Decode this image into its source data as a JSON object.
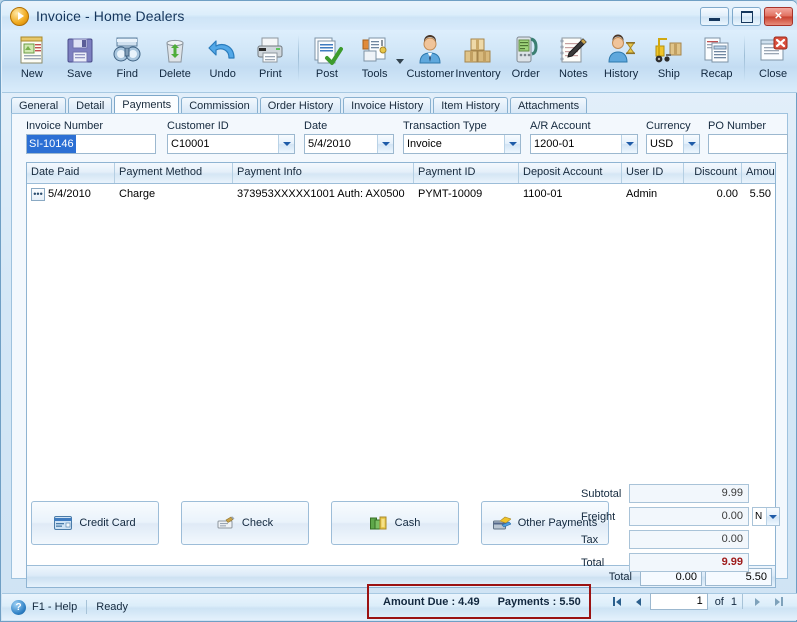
{
  "window": {
    "title": "Invoice - Home Dealers",
    "app_icon": "play-circle-icon",
    "buttons": {
      "minimize": "Minimize",
      "maximize": "Maximize",
      "close": "Close"
    }
  },
  "toolbar": {
    "items": [
      {
        "label": "New",
        "icon": "new-document-icon"
      },
      {
        "label": "Save",
        "icon": "floppy-disk-icon"
      },
      {
        "label": "Find",
        "icon": "binoculars-icon"
      },
      {
        "label": "Delete",
        "icon": "recycle-bin-icon"
      },
      {
        "label": "Undo",
        "icon": "undo-arrow-icon"
      },
      {
        "label": "Print",
        "icon": "printer-icon"
      },
      {
        "label": "Post",
        "icon": "post-checkmark-icon"
      },
      {
        "label": "Tools",
        "icon": "tools-wrench-icon",
        "has_dropdown": true
      },
      {
        "label": "Customer",
        "icon": "customer-person-icon"
      },
      {
        "label": "Inventory",
        "icon": "inventory-boxes-icon"
      },
      {
        "label": "Order",
        "icon": "order-device-icon"
      },
      {
        "label": "Notes",
        "icon": "notes-pencil-icon"
      },
      {
        "label": "History",
        "icon": "history-person-hourglass-icon"
      },
      {
        "label": "Ship",
        "icon": "forklift-icon"
      },
      {
        "label": "Recap",
        "icon": "recap-report-icon"
      },
      {
        "label": "Close",
        "icon": "close-window-icon"
      }
    ]
  },
  "tabs": [
    {
      "label": "General",
      "active": false
    },
    {
      "label": "Detail",
      "active": false
    },
    {
      "label": "Payments",
      "active": true
    },
    {
      "label": "Commission",
      "active": false
    },
    {
      "label": "Order History",
      "active": false
    },
    {
      "label": "Invoice History",
      "active": false
    },
    {
      "label": "Item History",
      "active": false
    },
    {
      "label": "Attachments",
      "active": false
    }
  ],
  "fields": {
    "invoice_number": {
      "label": "Invoice Number",
      "value": "SI-10146",
      "selected": true
    },
    "customer_id": {
      "label": "Customer ID",
      "value": "C10001"
    },
    "date": {
      "label": "Date",
      "value": "5/4/2010"
    },
    "transaction_type": {
      "label": "Transaction Type",
      "value": "Invoice"
    },
    "ar_account": {
      "label": "A/R Account",
      "value": "1200-01"
    },
    "currency": {
      "label": "Currency",
      "value": "USD"
    },
    "po_number": {
      "label": "PO Number",
      "value": ""
    }
  },
  "grid": {
    "columns": [
      {
        "label": "Date Paid",
        "align": "left"
      },
      {
        "label": "Payment Method",
        "align": "left"
      },
      {
        "label": "Payment Info",
        "align": "left"
      },
      {
        "label": "Payment ID",
        "align": "left"
      },
      {
        "label": "Deposit Account",
        "align": "left"
      },
      {
        "label": "User ID",
        "align": "left"
      },
      {
        "label": "Discount",
        "align": "right"
      },
      {
        "label": "Amount",
        "align": "right"
      }
    ],
    "rows": [
      {
        "date_paid": "5/4/2010",
        "payment_method": "Charge",
        "payment_info": "373953XXXXX1001 Auth: AX0500",
        "payment_id": "PYMT-10009",
        "deposit_account": "1100-01",
        "user_id": "Admin",
        "discount": "0.00",
        "amount": "5.50"
      }
    ],
    "total_label": "Total",
    "total_discount": "0.00",
    "total_amount": "5.50"
  },
  "payment_buttons": [
    {
      "label": "Credit Card",
      "icon": "credit-card-icon"
    },
    {
      "label": "Check",
      "icon": "check-icon"
    },
    {
      "label": "Cash",
      "icon": "cash-icon"
    },
    {
      "label": "Other Payments",
      "icon": "other-payments-icon"
    }
  ],
  "summary": {
    "subtotal_label": "Subtotal",
    "subtotal_value": "9.99",
    "freight_label": "Freight",
    "freight_value": "0.00",
    "freight_taxable": "N",
    "tax_label": "Tax",
    "tax_value": "0.00",
    "total_label": "Total",
    "total_value": "9.99",
    "total_color": "#9e1b1b"
  },
  "statusbar": {
    "help_icon": "help-question-icon",
    "help_text": "F1 - Help",
    "ready_text": "Ready",
    "amount_due": "Amount Due : 4.49",
    "payments": "Payments : 5.50",
    "highlight_color": "#9b1212",
    "page_current": "1",
    "page_of": "of",
    "page_total": "1",
    "nav": {
      "first": "first-record-icon",
      "previous": "previous-record-icon",
      "next": "next-record-icon",
      "last": "last-record-icon"
    }
  }
}
